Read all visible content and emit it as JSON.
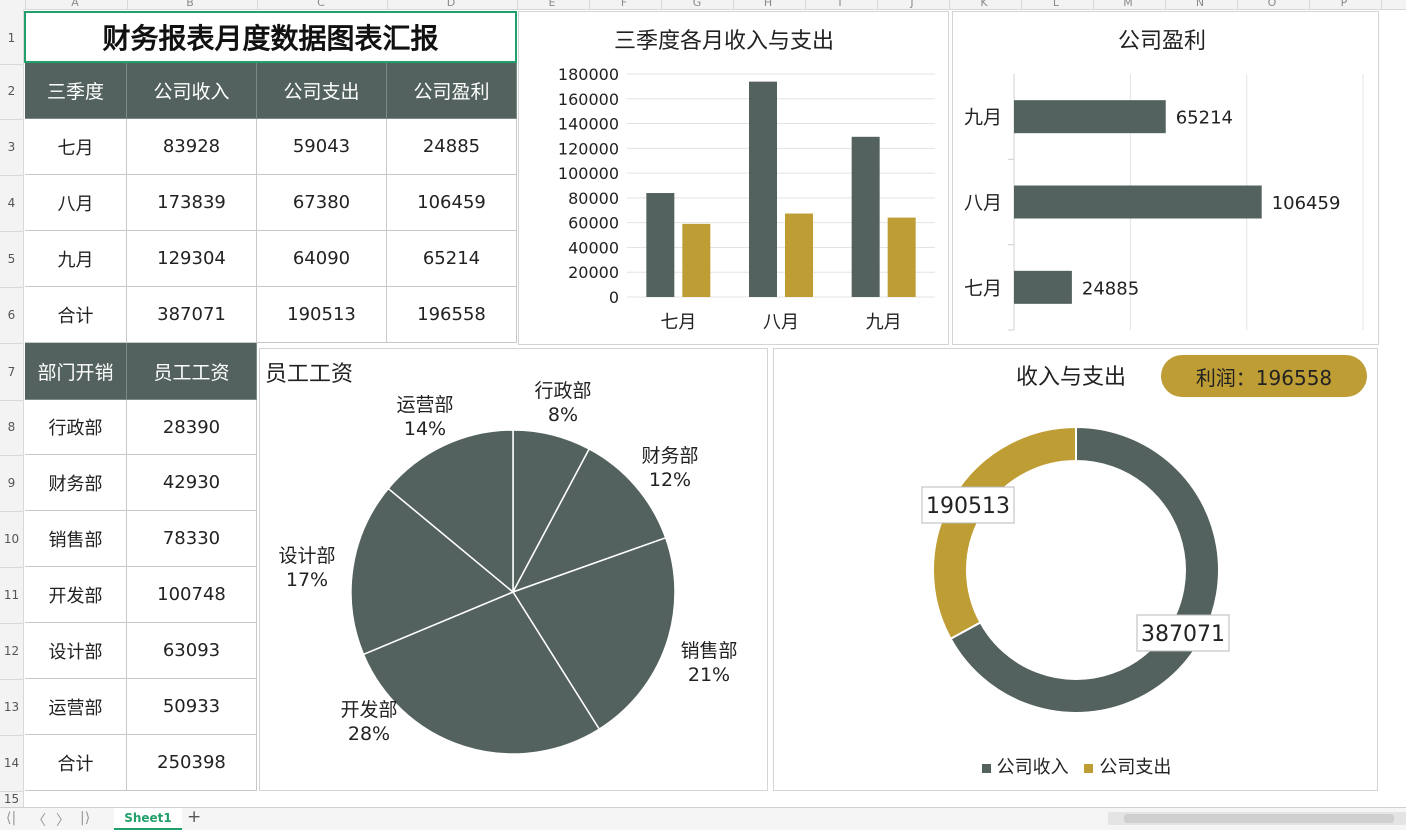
{
  "sheet": {
    "columns": [
      "A",
      "B",
      "C",
      "D",
      "E",
      "F",
      "G",
      "H",
      "I",
      "J",
      "K",
      "L",
      "M",
      "N",
      "O",
      "P"
    ],
    "rows": [
      "1",
      "2",
      "3",
      "4",
      "5",
      "6",
      "7",
      "8",
      "9",
      "10",
      "11",
      "12",
      "13",
      "14",
      "15"
    ],
    "tab_name": "Sheet1",
    "add_sheet_label": "+",
    "nav": [
      "⟨|",
      "〈",
      "〉",
      "|⟩"
    ]
  },
  "title": "财务报表月度数据图表汇报",
  "quarter_table": {
    "headers": [
      "三季度",
      "公司收入",
      "公司支出",
      "公司盈利"
    ],
    "rows": [
      [
        "七月",
        "83928",
        "59043",
        "24885"
      ],
      [
        "八月",
        "173839",
        "67380",
        "106459"
      ],
      [
        "九月",
        "129304",
        "64090",
        "65214"
      ],
      [
        "合计",
        "387071",
        "190513",
        "196558"
      ]
    ]
  },
  "dept_table": {
    "headers": [
      "部门开销",
      "员工工资"
    ],
    "rows": [
      [
        "行政部",
        "28390"
      ],
      [
        "财务部",
        "42930"
      ],
      [
        "销售部",
        "78330"
      ],
      [
        "开发部",
        "100748"
      ],
      [
        "设计部",
        "63093"
      ],
      [
        "运营部",
        "50933"
      ],
      [
        "合计",
        "250398"
      ]
    ]
  },
  "colors": {
    "dark": "#53625e",
    "gold": "#bf9d35",
    "header_green": "#22a06b"
  },
  "profit_badge": "利润：196558",
  "chart_data": [
    {
      "type": "bar",
      "title": "三季度各月收入与支出",
      "categories": [
        "七月",
        "八月",
        "九月"
      ],
      "series": [
        {
          "values": [
            83928,
            173839,
            129304
          ],
          "color": "#53625e"
        },
        {
          "values": [
            59043,
            67380,
            64090
          ],
          "color": "#bf9d35"
        }
      ],
      "ylim": [
        0,
        180000
      ],
      "yticks": [
        "0",
        "20000",
        "40000",
        "60000",
        "80000",
        "100000",
        "120000",
        "140000",
        "160000",
        "180000"
      ],
      "grid": true
    },
    {
      "type": "bar",
      "orientation": "horizontal",
      "title": "公司盈利",
      "categories": [
        "七月",
        "八月",
        "九月"
      ],
      "values": [
        24885,
        106459,
        65214
      ],
      "labels": [
        "24885",
        "106459",
        "65214"
      ],
      "xlim": [
        0,
        150000
      ],
      "grid": true
    },
    {
      "type": "pie",
      "title": "员工工资",
      "slices": [
        {
          "label": "行政部",
          "percent": "8%",
          "value": 28390
        },
        {
          "label": "财务部",
          "percent": "12%",
          "value": 42930
        },
        {
          "label": "销售部",
          "percent": "21%",
          "value": 78330
        },
        {
          "label": "开发部",
          "percent": "28%",
          "value": 100748
        },
        {
          "label": "设计部",
          "percent": "17%",
          "value": 63093
        },
        {
          "label": "运营部",
          "percent": "14%",
          "value": 50933
        }
      ]
    },
    {
      "type": "pie",
      "subtype": "doughnut",
      "title": "收入与支出",
      "slices": [
        {
          "label": "公司收入",
          "value": 387071,
          "value_label": "387071",
          "color": "#53625e"
        },
        {
          "label": "公司支出",
          "value": 190513,
          "value_label": "190513",
          "color": "#bf9d35"
        }
      ],
      "legend": [
        "公司收入",
        "公司支出"
      ],
      "legend_position": "bottom"
    }
  ]
}
